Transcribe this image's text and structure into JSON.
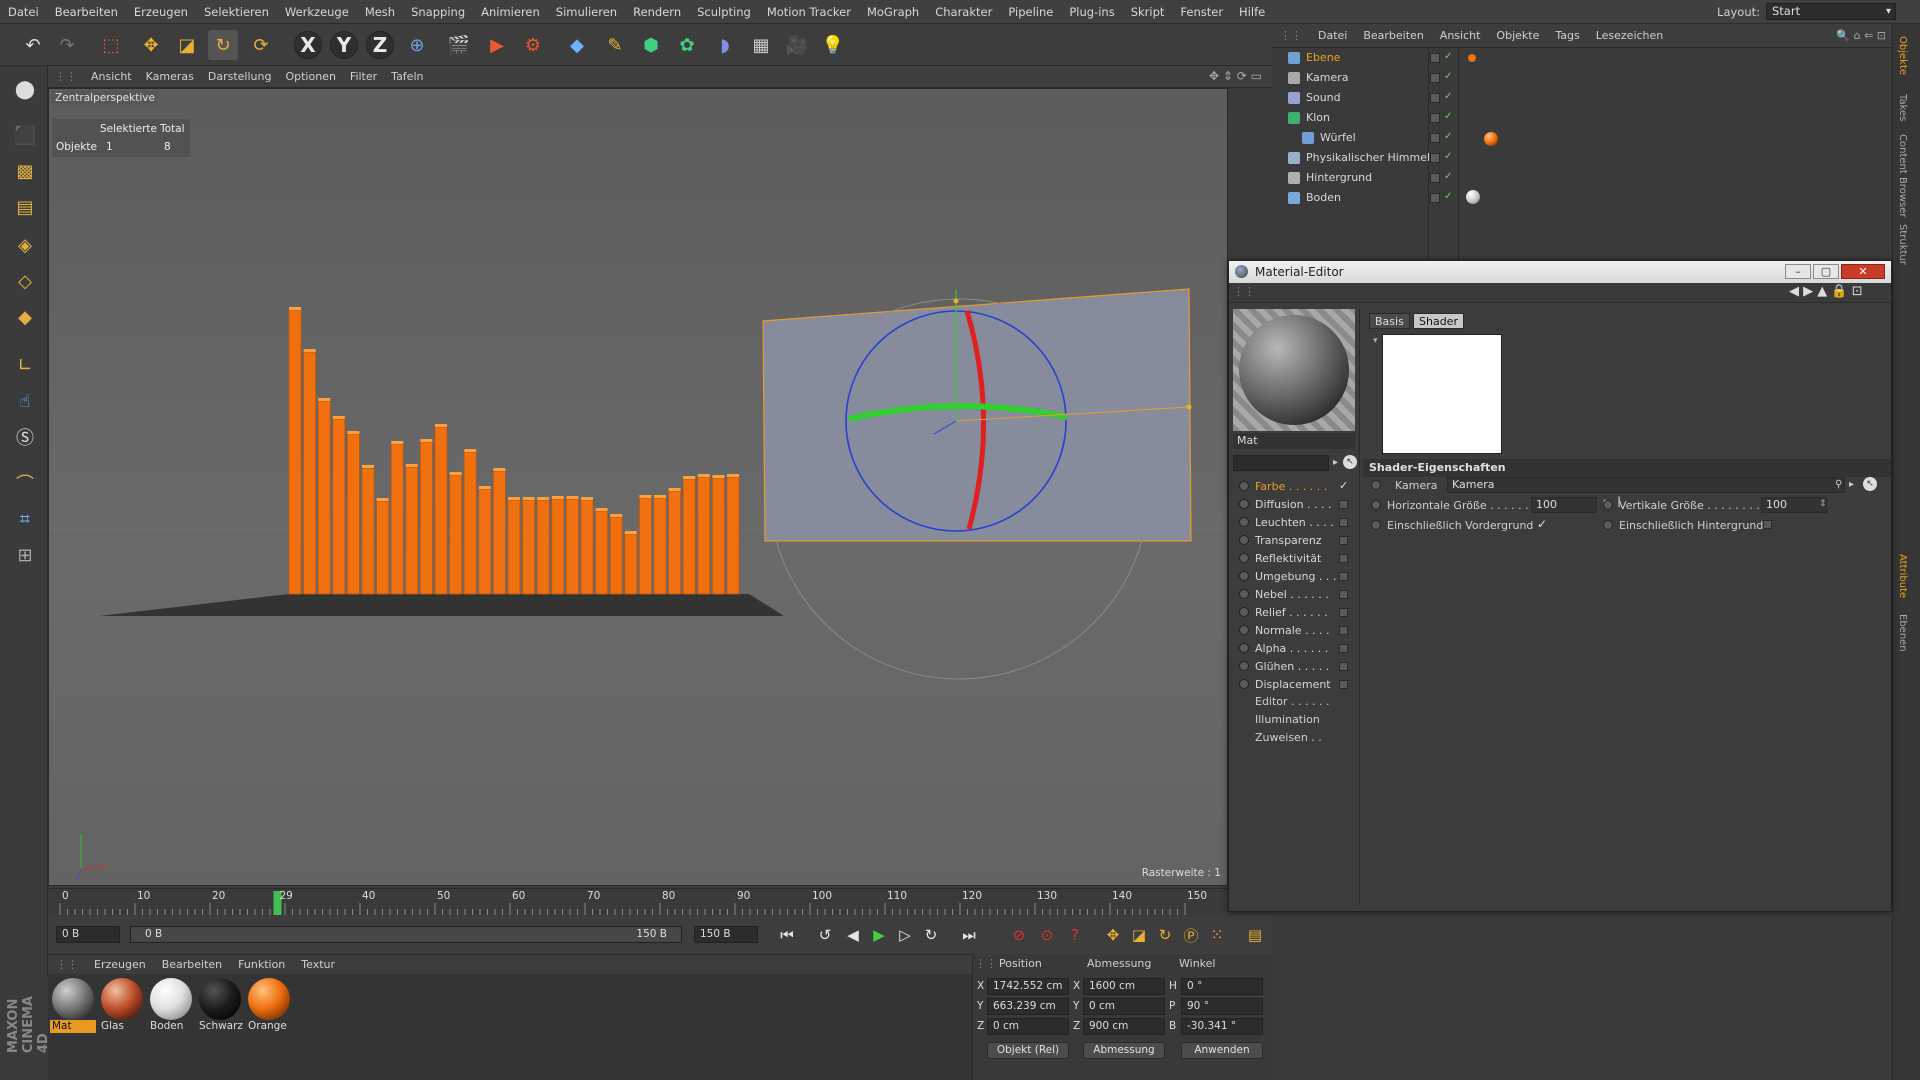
{
  "menubar": {
    "items": [
      "Datei",
      "Bearbeiten",
      "Erzeugen",
      "Selektieren",
      "Werkzeuge",
      "Mesh",
      "Snapping",
      "Animieren",
      "Simulieren",
      "Rendern",
      "Sculpting",
      "Motion Tracker",
      "MoGraph",
      "Charakter",
      "Pipeline",
      "Plug-ins",
      "Skript",
      "Fenster",
      "Hilfe"
    ],
    "layout_label": "Layout:",
    "layout_value": "Start"
  },
  "toolbar": {
    "axis_x": "X",
    "axis_y": "Y",
    "axis_z": "Z"
  },
  "viewport": {
    "menu": [
      "Ansicht",
      "Kameras",
      "Darstellung",
      "Optionen",
      "Filter",
      "Tafeln"
    ],
    "camera_label": "Zentralperspektive",
    "selection": {
      "col_selected": "Selektierte",
      "col_total": "Total",
      "row_label": "Objekte",
      "selected": "1",
      "total": "8"
    },
    "raster": "Rasterweite : 1"
  },
  "timeline": {
    "ticks": [
      "0",
      "10",
      "20",
      "29",
      "40",
      "50",
      "60",
      "70",
      "80",
      "90",
      "100",
      "110",
      "120",
      "130",
      "140",
      "150"
    ],
    "current_frame": "29",
    "end_label": "29",
    "start_field": "0 B",
    "range_start": "0 B",
    "range_end": "150 B",
    "end_field": "150 B"
  },
  "materials": {
    "menu": [
      "Erzeugen",
      "Bearbeiten",
      "Funktion",
      "Textur"
    ],
    "items": [
      {
        "name": "Mat",
        "color": "#7a7a7a"
      },
      {
        "name": "Glas",
        "color": "#c0502a"
      },
      {
        "name": "Boden",
        "color": "#e8e8e8"
      },
      {
        "name": "Schwarz",
        "color": "#1e1e1e"
      },
      {
        "name": "Orange",
        "color": "#f07010"
      }
    ]
  },
  "coords": {
    "h_position": "Position",
    "h_size": "Abmessung",
    "h_angle": "Winkel",
    "pos_x": "1742.552 cm",
    "pos_y": "663.239 cm",
    "pos_z": "0 cm",
    "size_x": "1600 cm",
    "size_y": "0 cm",
    "size_z": "900 cm",
    "rot_h": "0 °",
    "rot_p": "90 °",
    "rot_b": "-30.341 °",
    "mode": "Objekt (Rel)",
    "size_mode": "Abmessung",
    "apply": "Anwenden",
    "lbl_x": "X",
    "lbl_y": "Y",
    "lbl_z": "Z",
    "lbl_h": "H",
    "lbl_p": "P",
    "lbl_b": "B"
  },
  "object_manager": {
    "menu": [
      "Datei",
      "Bearbeiten",
      "Ansicht",
      "Objekte",
      "Tags",
      "Lesezeichen"
    ],
    "objects": [
      {
        "name": "Ebene",
        "color": "#e8a020",
        "icon": "#6fa0d8"
      },
      {
        "name": "Kamera",
        "color": "#d8d8d8",
        "icon": "#aaaaaa"
      },
      {
        "name": "Sound",
        "color": "#d8d8d8",
        "icon": "#9aa0d0"
      },
      {
        "name": "Klon",
        "color": "#d8d8d8",
        "icon": "#40b070"
      },
      {
        "name": "Würfel",
        "color": "#d8d8d8",
        "icon": "#6fa0d8"
      },
      {
        "name": "Physikalischer Himmel",
        "color": "#d8d8d8",
        "icon": "#9ab0c8"
      },
      {
        "name": "Hintergrund",
        "color": "#d8d8d8",
        "icon": "#b0b0b0"
      },
      {
        "name": "Boden",
        "color": "#d8d8d8",
        "icon": "#7aa8d8"
      }
    ]
  },
  "material_editor": {
    "title": "Material-Editor",
    "material_name": "Mat",
    "tabs": [
      "Basis",
      "Shader"
    ],
    "active_tab": "Shader",
    "channels": [
      {
        "name": "Farbe . . . . . .",
        "checked": true,
        "active": true
      },
      {
        "name": "Diffusion . . . .",
        "checked": false
      },
      {
        "name": "Leuchten . . . .",
        "checked": false
      },
      {
        "name": "Transparenz",
        "checked": false
      },
      {
        "name": "Reflektivität",
        "checked": false
      },
      {
        "name": "Umgebung . . .",
        "checked": false
      },
      {
        "name": "Nebel . . . . . .",
        "checked": false
      },
      {
        "name": "Relief . . . . . .",
        "checked": false
      },
      {
        "name": "Normale . . . .",
        "checked": false
      },
      {
        "name": "Alpha . . . . . .",
        "checked": false
      },
      {
        "name": "Glühen . . . . .",
        "checked": false
      },
      {
        "name": "Displacement",
        "checked": false
      }
    ],
    "extra": [
      "Editor . . . . . .",
      "Illumination",
      "Zuweisen . ."
    ],
    "section_title": "Shader-Eigenschaften",
    "camera_label": "Kamera",
    "camera_value": "Kamera",
    "h_size_label": "Horizontale Größe . . . . . . .",
    "h_size_value": "100",
    "v_size_label": "Vertikale Größe . . . . . . . . .",
    "v_size_value": "100",
    "incl_fg_label": "Einschließlich Vordergrund",
    "incl_bg_label": "Einschließlich Hintergrund"
  },
  "right_strip": [
    "Objekte",
    "Takes",
    "Content Browser",
    "Struktur",
    "Attribute",
    "Ebenen"
  ],
  "brand": "MAXON CINEMA 4D",
  "colors": {
    "accent": "#f07010",
    "selection": "#e8a020"
  }
}
